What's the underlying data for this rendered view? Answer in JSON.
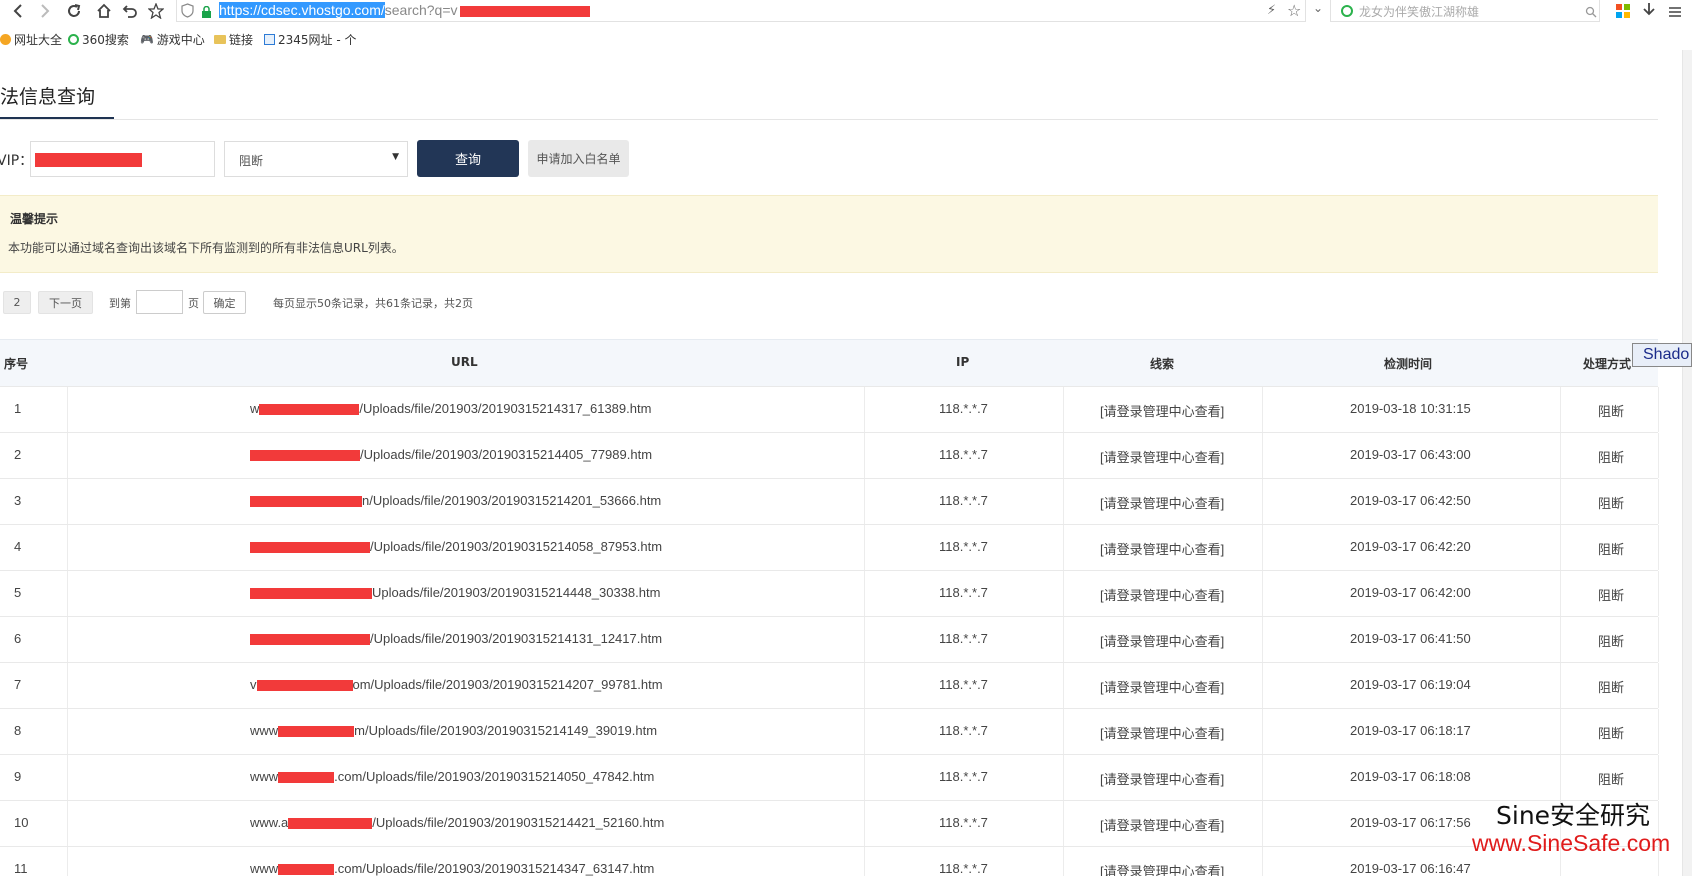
{
  "browser": {
    "url_selected": "https://cdsec.vhostgo.com/",
    "url_rest": "search?q=v",
    "search_placeholder": "龙女为伴笑傲江湖称雄"
  },
  "bookmarks": [
    {
      "label": "网址大全",
      "icon": "globe-icon"
    },
    {
      "label": "360搜索",
      "icon": "360-ring-icon"
    },
    {
      "label": "游戏中心",
      "icon": "gamepad-icon"
    },
    {
      "label": "链接",
      "icon": "folder-icon"
    },
    {
      "label": "2345网址 - 个",
      "icon": "2345-icon"
    }
  ],
  "page": {
    "title": "法信息查询"
  },
  "form": {
    "vip_label": "VIP：",
    "select_value": "阻断",
    "query_button": "查询",
    "whitelist_button": "申请加入白名单"
  },
  "notice": {
    "title": "温馨提示",
    "body": "本功能可以通过域名查询出该域名下所有监测到的所有非法信息URL列表。"
  },
  "pager": {
    "page_num": "2",
    "next": "下一页",
    "goto_prefix": "到第",
    "goto_suffix": "页",
    "confirm": "确定",
    "summary": "每页显示50条记录，共61条记录，共2页"
  },
  "table": {
    "headers": {
      "index": "序号",
      "url": "URL",
      "ip": "IP",
      "clue": "线索",
      "time": "检测时间",
      "action": "处理方式"
    },
    "rows": [
      {
        "index": "1",
        "url_prefix": "w",
        "redact_len": 100,
        "url_suffix": "/Uploads/file/201903/20190315214317_61389.htm",
        "ip": "118.*.*.7",
        "clue": "[请登录管理中心查看]",
        "time": "2019-03-18 10:31:15",
        "action": "阻断"
      },
      {
        "index": "2",
        "url_prefix": "",
        "redact_len": 110,
        "url_suffix": "/Uploads/file/201903/20190315214405_77989.htm",
        "ip": "118.*.*.7",
        "clue": "[请登录管理中心查看]",
        "time": "2019-03-17 06:43:00",
        "action": "阻断"
      },
      {
        "index": "3",
        "url_prefix": "",
        "redact_len": 112,
        "url_suffix": "n/Uploads/file/201903/20190315214201_53666.htm",
        "ip": "118.*.*.7",
        "clue": "[请登录管理中心查看]",
        "time": "2019-03-17 06:42:50",
        "action": "阻断"
      },
      {
        "index": "4",
        "url_prefix": "",
        "redact_len": 120,
        "url_suffix": "/Uploads/file/201903/20190315214058_87953.htm",
        "ip": "118.*.*.7",
        "clue": "[请登录管理中心查看]",
        "time": "2019-03-17 06:42:20",
        "action": "阻断"
      },
      {
        "index": "5",
        "url_prefix": "",
        "redact_len": 122,
        "url_suffix": "Uploads/file/201903/20190315214448_30338.htm",
        "ip": "118.*.*.7",
        "clue": "[请登录管理中心查看]",
        "time": "2019-03-17 06:42:00",
        "action": "阻断"
      },
      {
        "index": "6",
        "url_prefix": "",
        "redact_len": 120,
        "url_suffix": "/Uploads/file/201903/20190315214131_12417.htm",
        "ip": "118.*.*.7",
        "clue": "[请登录管理中心查看]",
        "time": "2019-03-17 06:41:50",
        "action": "阻断"
      },
      {
        "index": "7",
        "url_prefix": "v",
        "redact_len": 96,
        "url_suffix": "om/Uploads/file/201903/20190315214207_99781.htm",
        "ip": "118.*.*.7",
        "clue": "[请登录管理中心查看]",
        "time": "2019-03-17 06:19:04",
        "action": "阻断"
      },
      {
        "index": "8",
        "url_prefix": "www",
        "redact_len": 76,
        "url_suffix": "m/Uploads/file/201903/20190315214149_39019.htm",
        "ip": "118.*.*.7",
        "clue": "[请登录管理中心查看]",
        "time": "2019-03-17 06:18:17",
        "action": "阻断"
      },
      {
        "index": "9",
        "url_prefix": "www",
        "redact_len": 56,
        "url_suffix": ".com/Uploads/file/201903/20190315214050_47842.htm",
        "ip": "118.*.*.7",
        "clue": "[请登录管理中心查看]",
        "time": "2019-03-17 06:18:08",
        "action": "阻断"
      },
      {
        "index": "10",
        "url_prefix": "www.a",
        "redact_len": 84,
        "url_suffix": "/Uploads/file/201903/20190315214421_52160.htm",
        "ip": "118.*.*.7",
        "clue": "[请登录管理中心查看]",
        "time": "2019-03-17 06:17:56",
        "action": ""
      },
      {
        "index": "11",
        "url_prefix": "www",
        "redact_len": 56,
        "url_suffix": ".com/Uploads/file/201903/20190315214347_63147.htm",
        "ip": "118.*.*.7",
        "clue": "[请登录管理中心查看]",
        "time": "2019-03-17 06:16:47",
        "action": ""
      }
    ]
  },
  "overlay": {
    "shadow_tip": "Shado"
  },
  "watermark": {
    "line1": "Sine安全研究",
    "line2": "www.SineSafe.com"
  },
  "colors": {
    "primary_button": "#223656",
    "notice_bg": "#fcf8e3",
    "redaction": "#f23a3a",
    "watermark_red": "#e01b1b"
  }
}
